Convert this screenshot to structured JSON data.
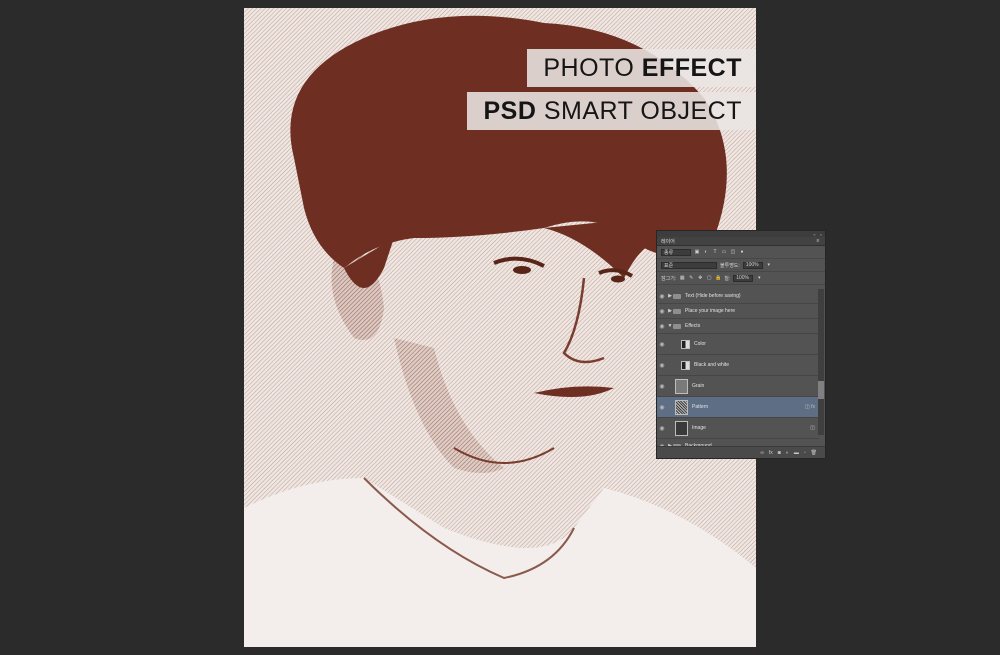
{
  "artwork": {
    "heading_line1_light": "PHOTO",
    "heading_line1_bold": "EFFECT",
    "heading_line2_bold": "PSD",
    "heading_line2_light": "SMART OBJECT",
    "ink_color": "#6e2f22",
    "paper_color": "#efe6e2"
  },
  "layers_panel": {
    "tab_label": "레이어",
    "filter_label": "종류",
    "blend_mode": "표준",
    "opacity_label": "불투명도:",
    "opacity_value": "100%",
    "lock_label": "잠그기:",
    "fill_label": "칠:",
    "fill_value": "100%",
    "layers": [
      {
        "name": "Text (Hide before saving)",
        "kind": "group",
        "expanded": false
      },
      {
        "name": "Place your image here",
        "kind": "group",
        "expanded": false
      },
      {
        "name": "Effects",
        "kind": "group",
        "expanded": true
      },
      {
        "name": "Color",
        "kind": "adjustment"
      },
      {
        "name": "Black and white",
        "kind": "adjustment"
      },
      {
        "name": "Grain",
        "kind": "fill"
      },
      {
        "name": "Pattern",
        "kind": "smart-object",
        "selected": true
      },
      {
        "name": "Image",
        "kind": "smart-object"
      },
      {
        "name": "Background",
        "kind": "group",
        "expanded": false
      }
    ],
    "footer_icons": [
      "link-icon",
      "fx-icon",
      "mask-icon",
      "adjustment-icon",
      "folder-icon",
      "new-layer-icon",
      "trash-icon"
    ]
  }
}
